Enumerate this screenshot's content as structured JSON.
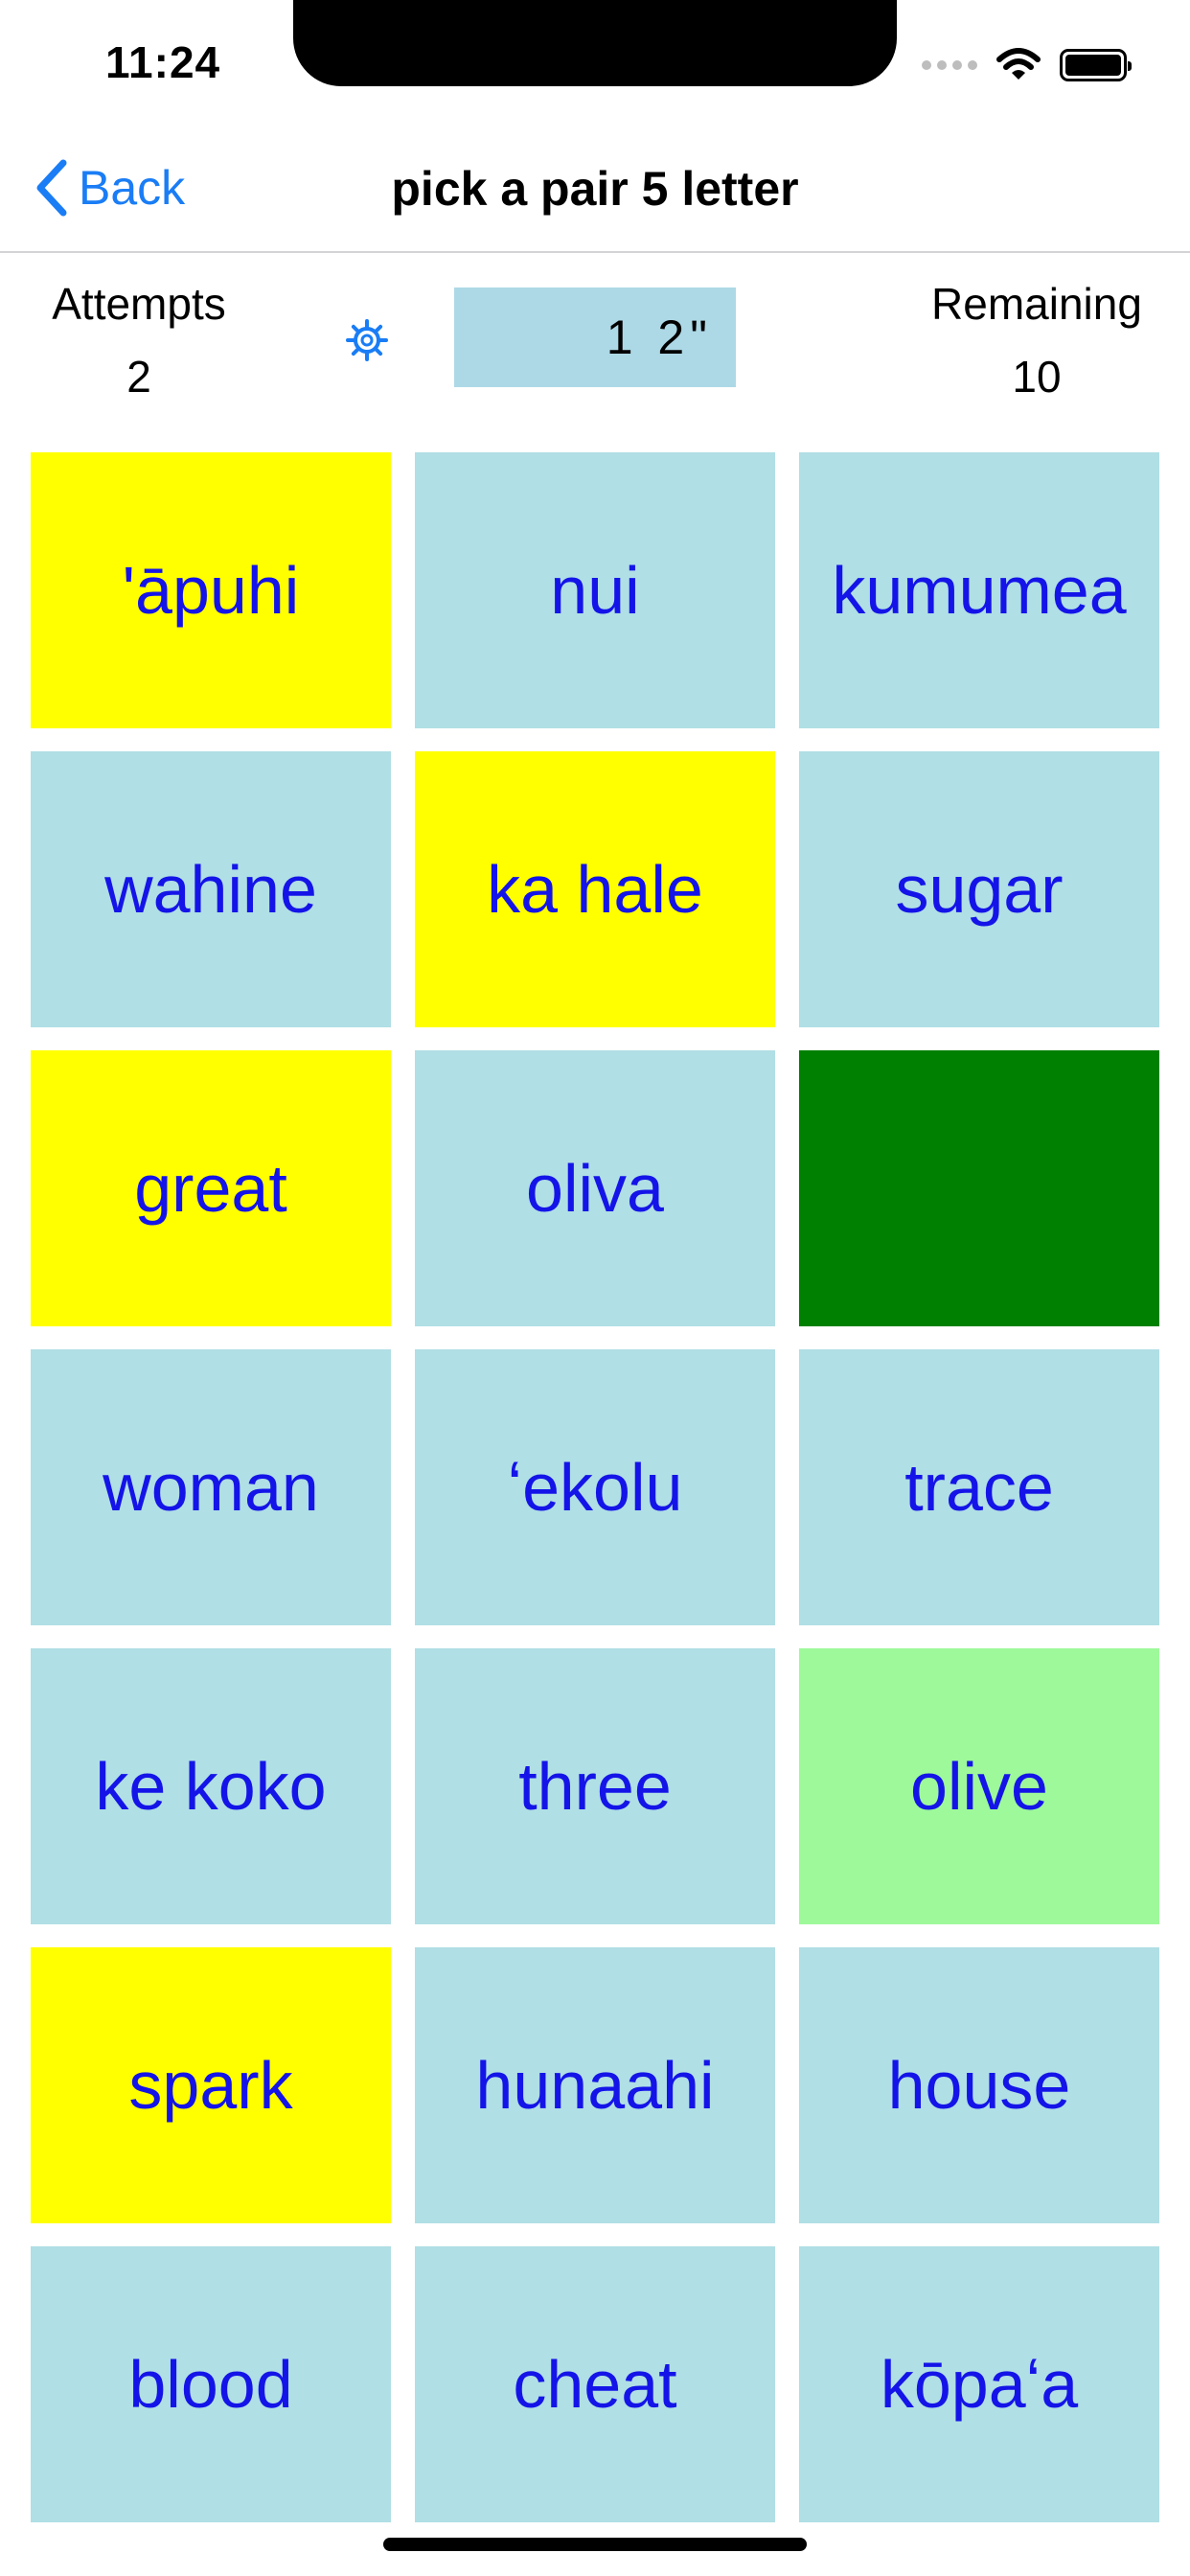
{
  "status_bar": {
    "time": "11:24"
  },
  "nav": {
    "back_label": "Back",
    "title": "pick a pair 5 letter"
  },
  "stats": {
    "attempts_label": "Attempts",
    "attempts_value": "2",
    "timer": "1 2\"",
    "remaining_label": "Remaining",
    "remaining_value": "10"
  },
  "colors": {
    "default_tile": "#b0dfe5",
    "selected_tile": "#ffff00",
    "matched_tile": "#008000",
    "hint_tile": "#9ef99a",
    "tile_text": "#1414e8",
    "accent": "#1a7df5"
  },
  "tiles": [
    {
      "label": "'āpuhi",
      "state": "selected",
      "bg": "#ffff00"
    },
    {
      "label": "nui",
      "state": "default",
      "bg": "#b0dfe5"
    },
    {
      "label": "kumumea",
      "state": "default",
      "bg": "#b0dfe5"
    },
    {
      "label": "wahine",
      "state": "default",
      "bg": "#b0dfe5"
    },
    {
      "label": "ka hale",
      "state": "selected",
      "bg": "#ffff00"
    },
    {
      "label": "sugar",
      "state": "default",
      "bg": "#b0dfe5"
    },
    {
      "label": "great",
      "state": "selected",
      "bg": "#ffff00"
    },
    {
      "label": "oliva",
      "state": "default",
      "bg": "#b0dfe5"
    },
    {
      "label": "",
      "state": "matched",
      "bg": "#008000"
    },
    {
      "label": "woman",
      "state": "default",
      "bg": "#b0dfe5"
    },
    {
      "label": "ʻekolu",
      "state": "default",
      "bg": "#b0dfe5"
    },
    {
      "label": "trace",
      "state": "default",
      "bg": "#b0dfe5"
    },
    {
      "label": "ke koko",
      "state": "default",
      "bg": "#b0dfe5"
    },
    {
      "label": "three",
      "state": "default",
      "bg": "#b0dfe5"
    },
    {
      "label": "olive",
      "state": "hint",
      "bg": "#9ef99a"
    },
    {
      "label": "spark",
      "state": "selected",
      "bg": "#ffff00"
    },
    {
      "label": "hunaahi",
      "state": "default",
      "bg": "#b0dfe5"
    },
    {
      "label": "house",
      "state": "default",
      "bg": "#b0dfe5"
    },
    {
      "label": "blood",
      "state": "default",
      "bg": "#b0dfe5"
    },
    {
      "label": "cheat",
      "state": "default",
      "bg": "#b0dfe5"
    },
    {
      "label": "kōpaʻa",
      "state": "default",
      "bg": "#b0dfe5"
    }
  ],
  "icons": {
    "back": "chevron-left-icon",
    "settings": "gear-icon",
    "wifi": "wifi-icon",
    "battery": "battery-icon",
    "signal": "signal-icon"
  }
}
